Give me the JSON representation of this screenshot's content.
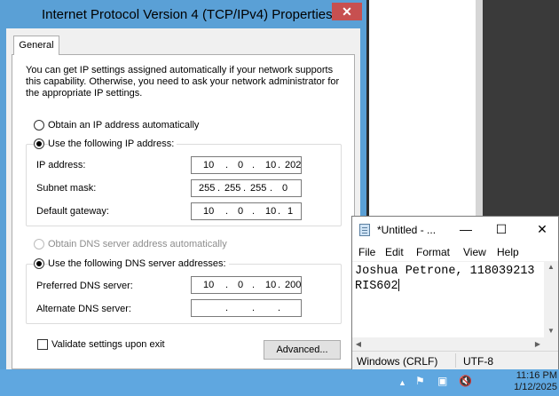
{
  "dialog": {
    "title": "Internet Protocol Version 4 (TCP/IPv4) Properties",
    "close_glyph": "✕",
    "tab_general": "General",
    "intro_text": "You can get IP settings assigned automatically if your network supports this capability. Otherwise, you need to ask your network administrator for the appropriate IP settings.",
    "ip_auto_label": "Obtain an IP address automatically",
    "ip_manual_label": "Use the following IP address:",
    "ip_address_label": "IP address:",
    "ip_address": [
      "10",
      "0",
      "10",
      "202"
    ],
    "subnet_label": "Subnet mask:",
    "subnet": [
      "255",
      "255",
      "255",
      "0"
    ],
    "gateway_label": "Default gateway:",
    "gateway": [
      "10",
      "0",
      "10",
      "1"
    ],
    "dns_auto_label": "Obtain DNS server address automatically",
    "dns_manual_label": "Use the following DNS server addresses:",
    "preferred_dns_label": "Preferred DNS server:",
    "preferred_dns": [
      "10",
      "0",
      "10",
      "200"
    ],
    "alternate_dns_label": "Alternate DNS server:",
    "alternate_dns": [
      "",
      "",
      "",
      ""
    ],
    "validate_label": "Validate settings upon exit",
    "advanced_label": "Advanced..."
  },
  "notepad": {
    "title": "*Untitled - ...",
    "minimize_glyph": "—",
    "maximize_glyph": "☐",
    "close_glyph": "✕",
    "menu": [
      "File",
      "Edit",
      "Format",
      "View",
      "Help"
    ],
    "text_lines": [
      "Joshua Petrone, 118039213",
      "RIS602"
    ],
    "status_line_ending": "Windows (CRLF)",
    "status_encoding": "UTF-8"
  },
  "taskbar": {
    "time": "11:16 PM",
    "date": "1/12/2025",
    "tray_icons": [
      "chevron-up-icon",
      "flag-icon",
      "network-icon",
      "volume-muted-icon"
    ]
  },
  "colors": {
    "title_bar": "#5aa0d6",
    "close_button": "#c75050",
    "taskbar": "#5fa7e0"
  }
}
